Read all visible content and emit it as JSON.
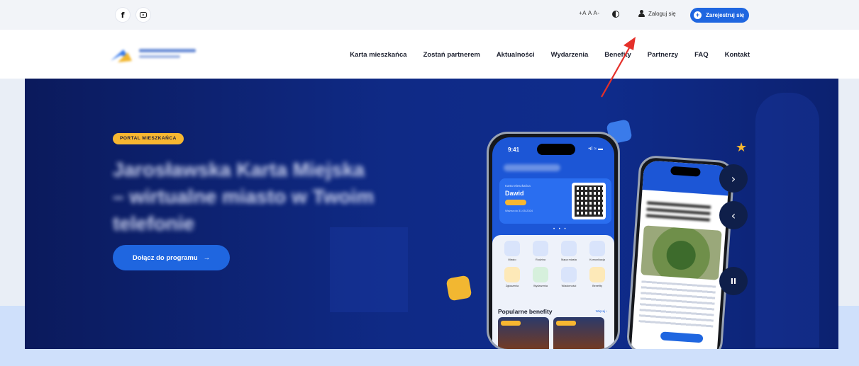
{
  "topbar": {
    "social": [
      {
        "name": "facebook",
        "glyph": "f"
      },
      {
        "name": "youtube",
        "glyph": ""
      }
    ],
    "font_size_controls": "+A A A-",
    "login_label": "Zaloguj się",
    "register_label": "Zarejestruj się"
  },
  "nav": {
    "items": [
      "Karta mieszkańca",
      "Zostań partnerem",
      "Aktualności",
      "Wydarzenia",
      "Benefity",
      "Partnerzy",
      "FAQ",
      "Kontakt"
    ]
  },
  "hero": {
    "badge": "PORTAL MIESZKAŃCA",
    "headline": "Jarosławska Karta Miejska – wirtualne miasto w Twoim telefonie",
    "cta_label": "Dołącz do programu",
    "cta_arrow": "→",
    "star": "★",
    "next_glyph": "›",
    "prev_glyph": "‹",
    "pause_glyph": "II"
  },
  "phone_main": {
    "time": "9:41",
    "status": "•ıl ≈ ▬",
    "card_small": "Karta Mieszkańca",
    "card_name": "Dawid",
    "card_valid": "Ważna do 31.05.2024",
    "dots": "• • •",
    "grid": [
      "Miasto",
      "Rodzina",
      "Mapa miasta",
      "Komunikacja",
      "Zgłoszenia",
      "Wydarzenia",
      "Wiadomości",
      "Benefity"
    ],
    "popular_title": "Popularne benefity",
    "more_label": "Więcej ›"
  },
  "colors": {
    "accent_blue": "#1f66e0",
    "badge_yellow": "#f7b731",
    "hero_navy": "#0f2a86",
    "annotation_red": "#e5302a"
  }
}
